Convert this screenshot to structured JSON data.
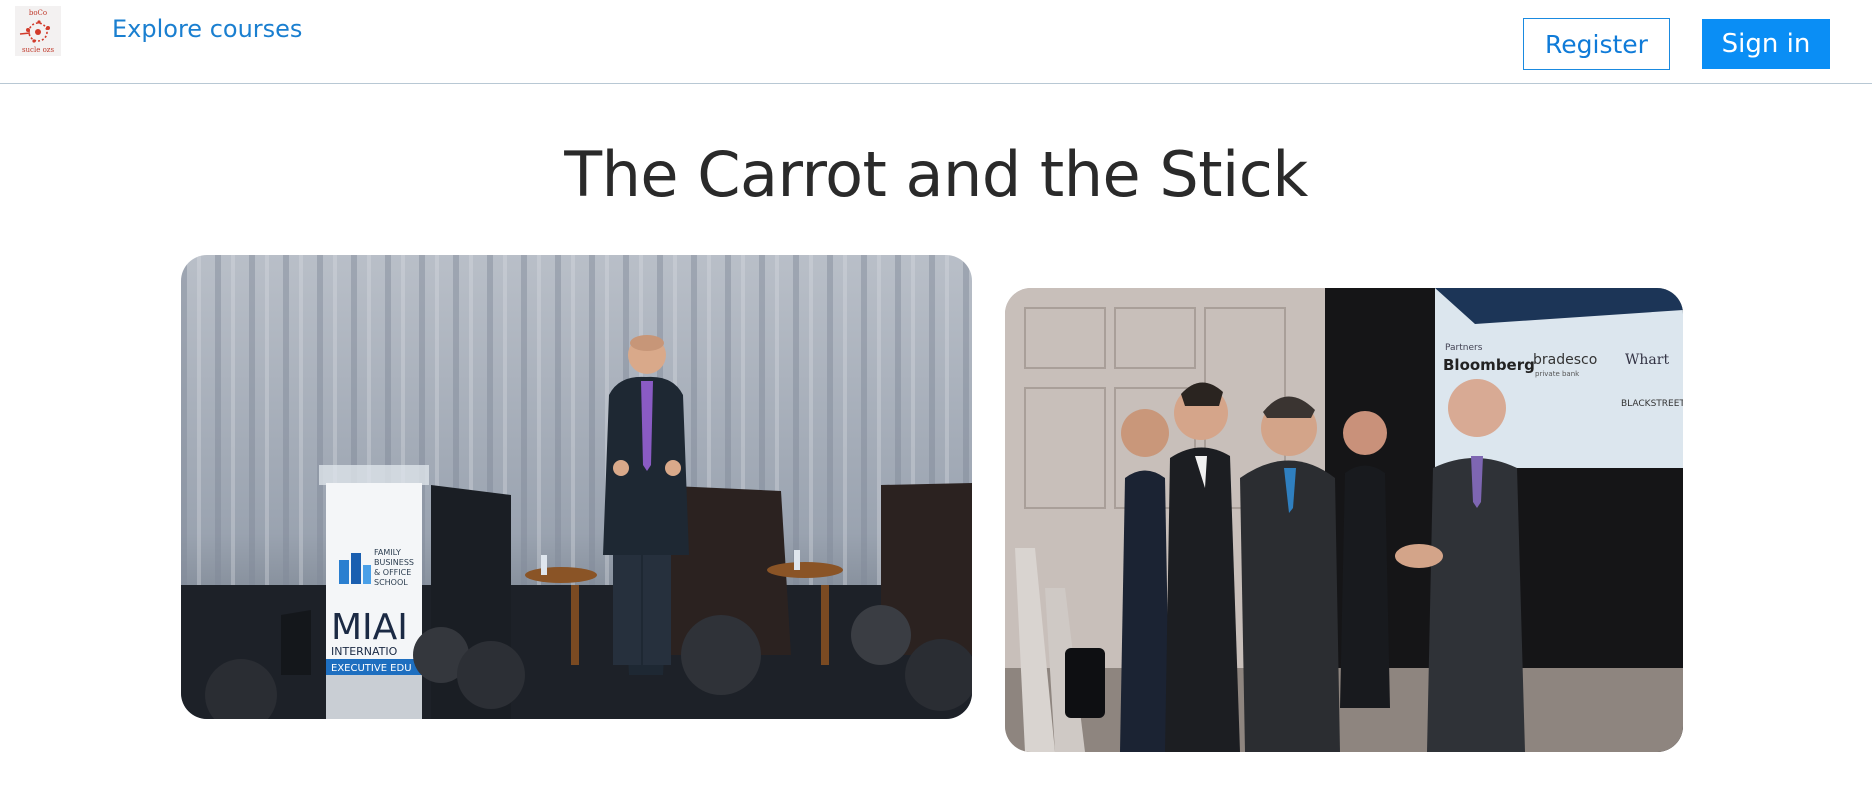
{
  "header": {
    "logo_text_top": "boCo",
    "logo_text_bottom": "sucle ozs",
    "explore_label": "Explore courses",
    "register_label": "Register",
    "signin_label": "Sign in"
  },
  "main": {
    "title": "The Carrot and the Stick"
  },
  "photos": {
    "podium": {
      "sign_lines": [
        "FAMILY",
        "BUSINESS",
        "& OFFICE",
        "SCHOOL"
      ],
      "sign_big": "MIAI",
      "sign_sub": "INTERNATIO",
      "sign_band": "EXECUTIVE EDU"
    },
    "networking": {
      "screen_partners_label": "Partners",
      "screen_logos": [
        "Bloomberg",
        "bradesco",
        "Whart",
        "BLACKSTREET"
      ],
      "screen_sub": "private bank"
    }
  },
  "colors": {
    "accent": "#0a8ef5",
    "link": "#1a7fd0",
    "title": "#2a2a2a"
  }
}
